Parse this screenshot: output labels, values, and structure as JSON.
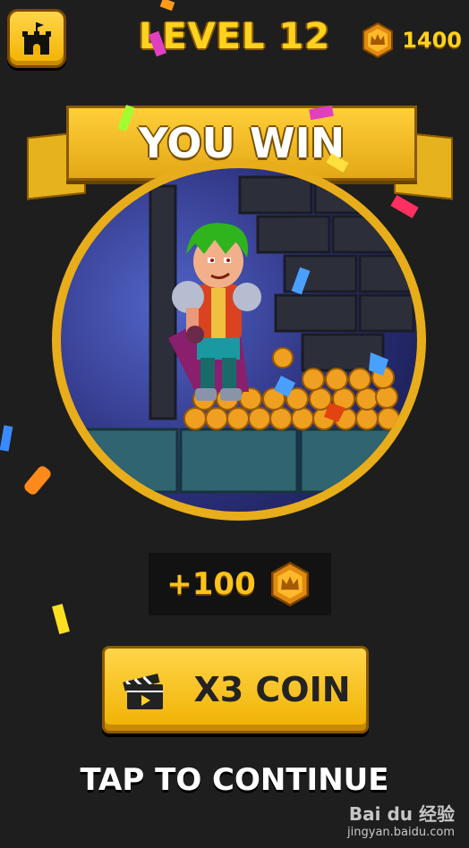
{
  "header": {
    "home_icon": "castle-icon",
    "level_title": "LEVEL 12",
    "coin_icon": "crown-coin-icon",
    "coin_count": "1400"
  },
  "banner": {
    "text": "YOU WIN"
  },
  "reward": {
    "amount": "+100",
    "icon": "crown-coin-icon"
  },
  "multiplier_button": {
    "label": "X3 COIN",
    "icon": "clapperboard-icon"
  },
  "tap_to_continue": "TAP TO CONTINUE",
  "watermark": {
    "line1": "Bai du 经验",
    "line2": "jingyan.baidu.com"
  },
  "colors": {
    "background": "#1e1e1e",
    "gold": "#ffd21f",
    "banner_gold": "#f2b200",
    "portrait_ring": "#e8ad1a"
  }
}
